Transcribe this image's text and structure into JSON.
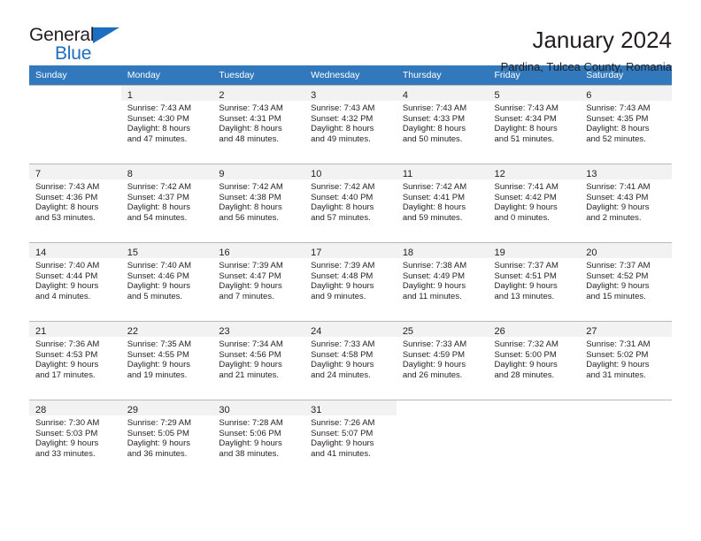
{
  "brand": {
    "word_one": "General",
    "word_two": "Blue",
    "logo_icon": "triangle-logo-icon"
  },
  "header": {
    "title": "January 2024",
    "subtitle": "Pardina, Tulcea County, Romania"
  },
  "colors": {
    "header_band": "#3179bc",
    "brand_blue": "#1b6ec2",
    "day_band": "#f2f2f2",
    "grid_line": "#b9b9b9",
    "text": "#231f20"
  },
  "weekday_headers": [
    "Sunday",
    "Monday",
    "Tuesday",
    "Wednesday",
    "Thursday",
    "Friday",
    "Saturday"
  ],
  "labels": {
    "sunrise_prefix": "Sunrise:",
    "sunset_prefix": "Sunset:",
    "daylight_prefix": "Daylight:"
  },
  "weeks": [
    [
      {
        "empty": true
      },
      {
        "day": "1",
        "line1": "Sunrise: 7:43 AM",
        "line2": "Sunset: 4:30 PM",
        "line3": "Daylight: 8 hours",
        "line4": "and 47 minutes."
      },
      {
        "day": "2",
        "line1": "Sunrise: 7:43 AM",
        "line2": "Sunset: 4:31 PM",
        "line3": "Daylight: 8 hours",
        "line4": "and 48 minutes."
      },
      {
        "day": "3",
        "line1": "Sunrise: 7:43 AM",
        "line2": "Sunset: 4:32 PM",
        "line3": "Daylight: 8 hours",
        "line4": "and 49 minutes."
      },
      {
        "day": "4",
        "line1": "Sunrise: 7:43 AM",
        "line2": "Sunset: 4:33 PM",
        "line3": "Daylight: 8 hours",
        "line4": "and 50 minutes."
      },
      {
        "day": "5",
        "line1": "Sunrise: 7:43 AM",
        "line2": "Sunset: 4:34 PM",
        "line3": "Daylight: 8 hours",
        "line4": "and 51 minutes."
      },
      {
        "day": "6",
        "line1": "Sunrise: 7:43 AM",
        "line2": "Sunset: 4:35 PM",
        "line3": "Daylight: 8 hours",
        "line4": "and 52 minutes."
      }
    ],
    [
      {
        "day": "7",
        "line1": "Sunrise: 7:43 AM",
        "line2": "Sunset: 4:36 PM",
        "line3": "Daylight: 8 hours",
        "line4": "and 53 minutes."
      },
      {
        "day": "8",
        "line1": "Sunrise: 7:42 AM",
        "line2": "Sunset: 4:37 PM",
        "line3": "Daylight: 8 hours",
        "line4": "and 54 minutes."
      },
      {
        "day": "9",
        "line1": "Sunrise: 7:42 AM",
        "line2": "Sunset: 4:38 PM",
        "line3": "Daylight: 8 hours",
        "line4": "and 56 minutes."
      },
      {
        "day": "10",
        "line1": "Sunrise: 7:42 AM",
        "line2": "Sunset: 4:40 PM",
        "line3": "Daylight: 8 hours",
        "line4": "and 57 minutes."
      },
      {
        "day": "11",
        "line1": "Sunrise: 7:42 AM",
        "line2": "Sunset: 4:41 PM",
        "line3": "Daylight: 8 hours",
        "line4": "and 59 minutes."
      },
      {
        "day": "12",
        "line1": "Sunrise: 7:41 AM",
        "line2": "Sunset: 4:42 PM",
        "line3": "Daylight: 9 hours",
        "line4": "and 0 minutes."
      },
      {
        "day": "13",
        "line1": "Sunrise: 7:41 AM",
        "line2": "Sunset: 4:43 PM",
        "line3": "Daylight: 9 hours",
        "line4": "and 2 minutes."
      }
    ],
    [
      {
        "day": "14",
        "line1": "Sunrise: 7:40 AM",
        "line2": "Sunset: 4:44 PM",
        "line3": "Daylight: 9 hours",
        "line4": "and 4 minutes."
      },
      {
        "day": "15",
        "line1": "Sunrise: 7:40 AM",
        "line2": "Sunset: 4:46 PM",
        "line3": "Daylight: 9 hours",
        "line4": "and 5 minutes."
      },
      {
        "day": "16",
        "line1": "Sunrise: 7:39 AM",
        "line2": "Sunset: 4:47 PM",
        "line3": "Daylight: 9 hours",
        "line4": "and 7 minutes."
      },
      {
        "day": "17",
        "line1": "Sunrise: 7:39 AM",
        "line2": "Sunset: 4:48 PM",
        "line3": "Daylight: 9 hours",
        "line4": "and 9 minutes."
      },
      {
        "day": "18",
        "line1": "Sunrise: 7:38 AM",
        "line2": "Sunset: 4:49 PM",
        "line3": "Daylight: 9 hours",
        "line4": "and 11 minutes."
      },
      {
        "day": "19",
        "line1": "Sunrise: 7:37 AM",
        "line2": "Sunset: 4:51 PM",
        "line3": "Daylight: 9 hours",
        "line4": "and 13 minutes."
      },
      {
        "day": "20",
        "line1": "Sunrise: 7:37 AM",
        "line2": "Sunset: 4:52 PM",
        "line3": "Daylight: 9 hours",
        "line4": "and 15 minutes."
      }
    ],
    [
      {
        "day": "21",
        "line1": "Sunrise: 7:36 AM",
        "line2": "Sunset: 4:53 PM",
        "line3": "Daylight: 9 hours",
        "line4": "and 17 minutes."
      },
      {
        "day": "22",
        "line1": "Sunrise: 7:35 AM",
        "line2": "Sunset: 4:55 PM",
        "line3": "Daylight: 9 hours",
        "line4": "and 19 minutes."
      },
      {
        "day": "23",
        "line1": "Sunrise: 7:34 AM",
        "line2": "Sunset: 4:56 PM",
        "line3": "Daylight: 9 hours",
        "line4": "and 21 minutes."
      },
      {
        "day": "24",
        "line1": "Sunrise: 7:33 AM",
        "line2": "Sunset: 4:58 PM",
        "line3": "Daylight: 9 hours",
        "line4": "and 24 minutes."
      },
      {
        "day": "25",
        "line1": "Sunrise: 7:33 AM",
        "line2": "Sunset: 4:59 PM",
        "line3": "Daylight: 9 hours",
        "line4": "and 26 minutes."
      },
      {
        "day": "26",
        "line1": "Sunrise: 7:32 AM",
        "line2": "Sunset: 5:00 PM",
        "line3": "Daylight: 9 hours",
        "line4": "and 28 minutes."
      },
      {
        "day": "27",
        "line1": "Sunrise: 7:31 AM",
        "line2": "Sunset: 5:02 PM",
        "line3": "Daylight: 9 hours",
        "line4": "and 31 minutes."
      }
    ],
    [
      {
        "day": "28",
        "line1": "Sunrise: 7:30 AM",
        "line2": "Sunset: 5:03 PM",
        "line3": "Daylight: 9 hours",
        "line4": "and 33 minutes."
      },
      {
        "day": "29",
        "line1": "Sunrise: 7:29 AM",
        "line2": "Sunset: 5:05 PM",
        "line3": "Daylight: 9 hours",
        "line4": "and 36 minutes."
      },
      {
        "day": "30",
        "line1": "Sunrise: 7:28 AM",
        "line2": "Sunset: 5:06 PM",
        "line3": "Daylight: 9 hours",
        "line4": "and 38 minutes."
      },
      {
        "day": "31",
        "line1": "Sunrise: 7:26 AM",
        "line2": "Sunset: 5:07 PM",
        "line3": "Daylight: 9 hours",
        "line4": "and 41 minutes."
      },
      {
        "empty": true
      },
      {
        "empty": true
      },
      {
        "empty": true
      }
    ]
  ]
}
